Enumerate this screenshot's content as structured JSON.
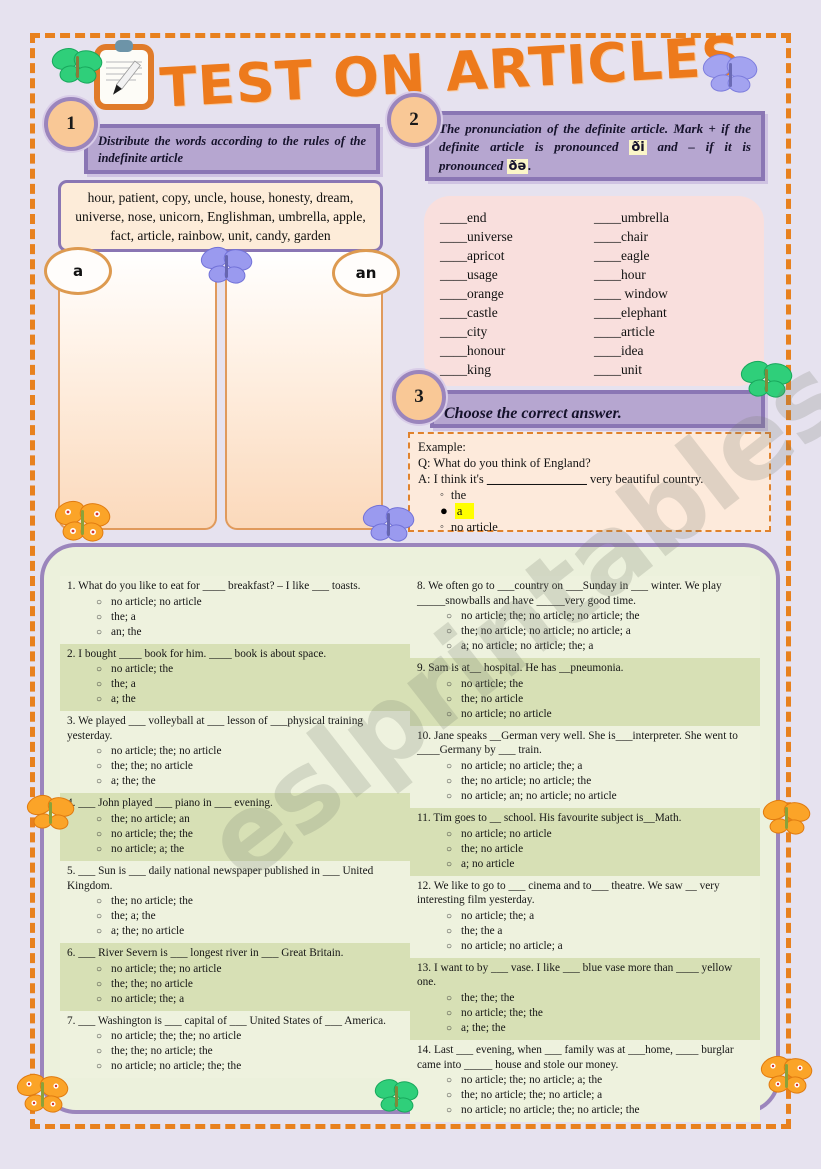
{
  "page": {
    "title": "TEST ON ARTICLES",
    "watermark": "eslprintables.com",
    "colors": {
      "background": "#e6e2ef",
      "frame_dashed": "#e8811e",
      "title_orange": "#ed7a1c",
      "instruction_purple": "#b6a6d0",
      "badge_peach": "#f9c896",
      "task2_pink": "#f9dfdd",
      "green_panel": "#ecf1dc",
      "row_dark": "#d7e0b5",
      "highlight_yellow": "#ffff00"
    }
  },
  "tasks": [
    {
      "number": "1",
      "instruction": "Distribute the words according to the rules of the indefinite article",
      "wordbank": "hour, patient, copy, uncle, house, honesty, dream, universe, nose, unicorn, Englishman, umbrella, apple, fact, article, rainbow, unit, candy, garden",
      "column_labels": [
        "a",
        "an"
      ]
    },
    {
      "number": "2",
      "instruction_part1": "The pronunciation of the definite article. Mark + if the definite article is pronounced",
      "ipa1": "ði",
      "instruction_part2": "and – if it is pronounced",
      "ipa2": "ðə",
      "instruction_part3": ".",
      "left_column": [
        "____end",
        "____universe",
        "____apricot",
        "____usage",
        "____orange",
        "____castle",
        "____city",
        "____honour",
        "____king"
      ],
      "right_column": [
        "____umbrella",
        "____chair",
        "____eagle",
        "____hour",
        "____ window",
        "____elephant",
        "____article",
        "____idea",
        "____unit"
      ]
    },
    {
      "number": "3",
      "instruction": "Choose the correct answer."
    }
  ],
  "example": {
    "label": "Example:",
    "question": "Q: What do you think of England?",
    "answer_prefix": "A: I think it's",
    "answer_blank": "________________",
    "answer_suffix": "very beautiful country.",
    "options": [
      {
        "text": "the",
        "selected": false
      },
      {
        "text": "a",
        "selected": true
      },
      {
        "text": "no article",
        "selected": false
      }
    ]
  },
  "questions_left": [
    {
      "num": "1.",
      "text": "What do you like to eat for ____ breakfast? – I like ___ toasts.",
      "options": [
        "no article; no article",
        "the; a",
        "an; the"
      ]
    },
    {
      "num": "2.",
      "text": "I bought ____ book for him. ____ book is about space.",
      "options": [
        "no article; the",
        "the; a",
        "a; the"
      ]
    },
    {
      "num": "3.",
      "text": "We played ___ volleyball at ___ lesson of ___physical training yesterday.",
      "options": [
        "no article; the; no article",
        "the; the; no article",
        "a; the; the"
      ]
    },
    {
      "num": "4.",
      "text": "___ John played ___ piano in ___ evening.",
      "options": [
        "the; no article; an",
        "no article; the; the",
        "no article; a; the"
      ]
    },
    {
      "num": "5.",
      "text": "___ Sun is ___ daily national newspaper published in ___ United Kingdom.",
      "options": [
        "the; no article; the",
        "the; a; the",
        "a; the; no article"
      ]
    },
    {
      "num": "6.",
      "text": "___ River Severn is ___ longest river in ___ Great Britain.",
      "options": [
        "no article; the; no article",
        "the; the; no article",
        "no article; the; a"
      ]
    },
    {
      "num": "7.",
      "text": "___ Washington is ___ capital of ___ United States of ___ America.",
      "options": [
        "no article; the; the; no article",
        "the; the; no article; the",
        "no article; no article; the; the"
      ]
    }
  ],
  "questions_right": [
    {
      "num": "8.",
      "text": "We often go to ___country on ___Sunday in ___ winter. We play _____snowballs and have _____very good time.",
      "options": [
        "no article; the; no article; no article; the",
        "the; no article; no article; no article; a",
        "a; no article; no article; the; a"
      ]
    },
    {
      "num": "9.",
      "text": "Sam is at__ hospital. He has __pneumonia.",
      "options": [
        "no article; the",
        "the; no article",
        "no article; no article"
      ]
    },
    {
      "num": "10.",
      "text": "Jane speaks __German very well. She is___interpreter. She went to ____Germany by ___ train.",
      "options": [
        "no article; no article; the; a",
        "the; no article; no article; the",
        "no article; an; no article; no article"
      ]
    },
    {
      "num": "11.",
      "text": "Tim goes to __ school. His favourite subject is__Math.",
      "options": [
        "no article; no article",
        "the; no article",
        "a; no article"
      ]
    },
    {
      "num": "12.",
      "text": "We like to go to ___ cinema and to___ theatre. We saw __ very interesting film yesterday.",
      "options": [
        "no article; the; a",
        "the; the a",
        "no article; no article; a"
      ]
    },
    {
      "num": "13.",
      "text": "I want to by ___ vase. I like ___ blue vase more than ____ yellow one.",
      "options": [
        "the; the; the",
        "no article; the; the",
        "a; the; the"
      ]
    },
    {
      "num": "14.",
      "text": "Last ___ evening, when ___ family was at ___home, ____ burglar came into _____ house and stole our money.",
      "options": [
        "no article; the; no article; a; the",
        "the; no article; the; no article; a",
        "no article; no article; the; no article; the"
      ]
    }
  ],
  "icons": {
    "clipboard": "clipboard-pencil-icon",
    "butterfly": "butterfly-icon"
  }
}
